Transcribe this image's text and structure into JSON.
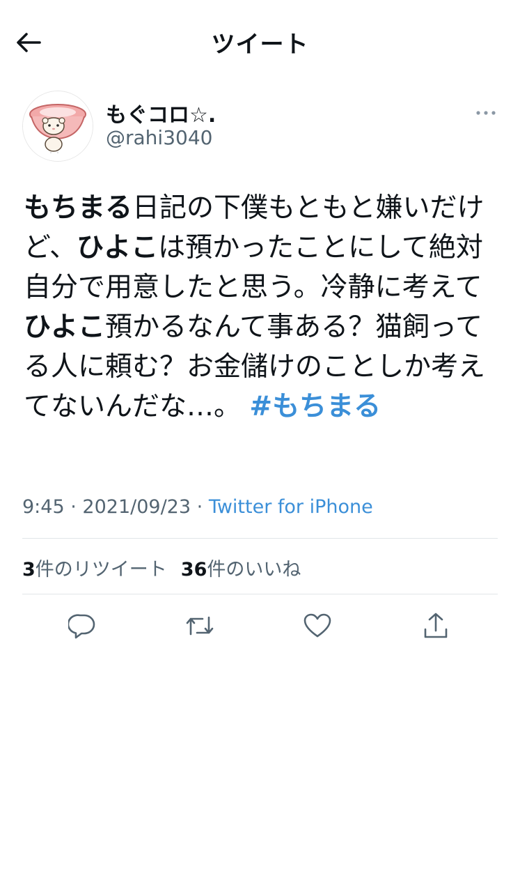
{
  "header": {
    "title": "ツイート",
    "back_icon": "arrow-left-icon"
  },
  "author": {
    "display_name": "もぐコロ☆.",
    "handle": "@rahi3040",
    "avatar_icon": "hamster-in-bowl-avatar"
  },
  "tweet": {
    "segments": [
      {
        "text": "もちまる",
        "bold": true
      },
      {
        "text": "日記の下僕もともと嫌いだけど、",
        "bold": false
      },
      {
        "text": "ひよこ",
        "bold": true
      },
      {
        "text": "は預かったことにして絶対自分で用意したと思う。冷静に考えて",
        "bold": false
      },
      {
        "text": "ひよこ",
        "bold": true
      },
      {
        "text": "預かるなんて事ある？猫飼ってる人に頼む？お金儲けのことしか考えてないんだな…。 ",
        "bold": false
      }
    ],
    "hashtag": "#もちまる",
    "time": "9:45",
    "date": "2021/09/23",
    "separator": "·",
    "source": "Twitter for iPhone"
  },
  "stats": {
    "retweets_count": "3",
    "retweets_label": "件のリツイート",
    "likes_count": "36",
    "likes_label": "件のいいね"
  },
  "actions": [
    {
      "icon": "reply-icon"
    },
    {
      "icon": "retweet-icon"
    },
    {
      "icon": "like-heart-icon"
    },
    {
      "icon": "share-icon"
    }
  ],
  "colors": {
    "text": "#0f1419",
    "secondary": "#536471",
    "link": "#3b8fd8",
    "divider": "#e1e5e8"
  }
}
